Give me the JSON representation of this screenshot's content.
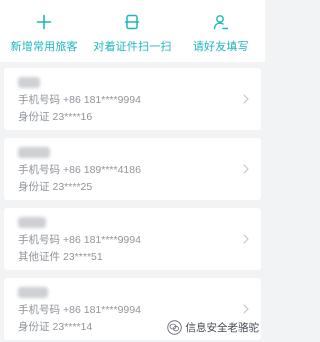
{
  "actions": [
    {
      "label": "新增常用旅客",
      "icon": "plus-icon"
    },
    {
      "label": "对着证件扫一扫",
      "icon": "scan-icon"
    },
    {
      "label": "请好友填写",
      "icon": "person-edit-icon"
    }
  ],
  "passengers": [
    {
      "name": "",
      "phone_label": "手机号码",
      "phone": "+86 181****9994",
      "id_label": "身份证",
      "id": "23****16"
    },
    {
      "name": "",
      "phone_label": "手机号码",
      "phone": "+86 189****4186",
      "id_label": "身份证",
      "id": "23****25"
    },
    {
      "name": "",
      "phone_label": "手机号码",
      "phone": "+86 181****9994",
      "id_label": "其他证件",
      "id": "23****51"
    },
    {
      "name": "",
      "phone_label": "手机号码",
      "phone": "+86 181****9994",
      "id_label": "身份证",
      "id": "23****14"
    }
  ],
  "watermark": {
    "text": "信息安全老骆驼",
    "icon": "wechat-icon"
  },
  "colors": {
    "accent": "#1db7bf",
    "text_secondary": "#8f959b",
    "background": "#f2f3f5"
  }
}
